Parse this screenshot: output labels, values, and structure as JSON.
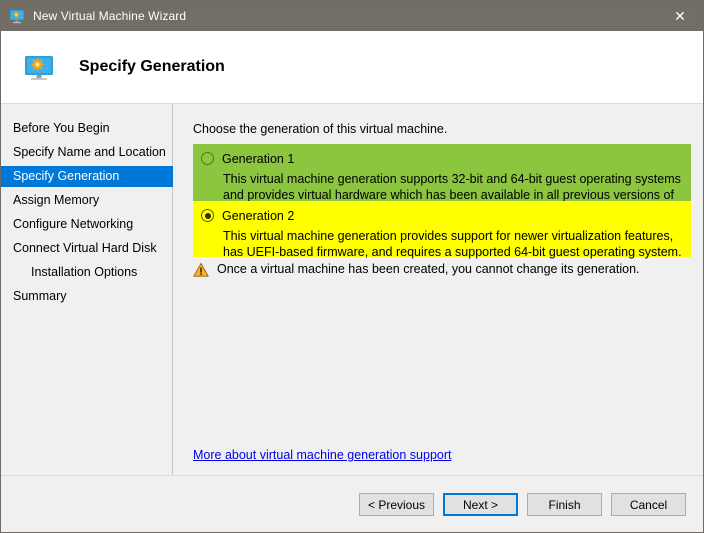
{
  "window": {
    "title": "New Virtual Machine Wizard",
    "title_icon": "virtual-machine-monitor-icon",
    "close_label": "✕",
    "titlebar_color": "#736d68"
  },
  "header": {
    "icon": "virtual-machine-monitor-icon",
    "title": "Specify Generation"
  },
  "sidebar": {
    "items": [
      {
        "label": "Before You Begin",
        "selected": false,
        "indent": false
      },
      {
        "label": "Specify Name and Location",
        "selected": false,
        "indent": false
      },
      {
        "label": "Specify Generation",
        "selected": true,
        "indent": false
      },
      {
        "label": "Assign Memory",
        "selected": false,
        "indent": false
      },
      {
        "label": "Configure Networking",
        "selected": false,
        "indent": false
      },
      {
        "label": "Connect Virtual Hard Disk",
        "selected": false,
        "indent": false
      },
      {
        "label": "Installation Options",
        "selected": false,
        "indent": true
      },
      {
        "label": "Summary",
        "selected": false,
        "indent": false
      }
    ],
    "selected_color": "#0078d7"
  },
  "main": {
    "intro": "Choose the generation of this virtual machine.",
    "options": [
      {
        "label": "Generation 1",
        "selected": false,
        "highlight_color": "#8cc63e",
        "description": "This virtual machine generation supports 32-bit and 64-bit guest operating systems and provides virtual hardware which has been available in all previous versions of Hyper-V."
      },
      {
        "label": "Generation 2",
        "selected": true,
        "highlight_color": "#ffff00",
        "description": "This virtual machine generation provides support for newer virtualization features, has UEFI-based firmware, and requires a supported 64-bit guest operating system."
      }
    ],
    "warning": {
      "icon": "warning-triangle-icon",
      "text": "Once a virtual machine has been created, you cannot change its generation."
    },
    "link": {
      "text": "More about virtual machine generation support",
      "color": "#0000ee"
    }
  },
  "footer": {
    "buttons": [
      {
        "label": "< Previous",
        "default": false
      },
      {
        "label": "Next >",
        "default": true
      },
      {
        "label": "Finish",
        "default": false
      },
      {
        "label": "Cancel",
        "default": false
      }
    ]
  }
}
